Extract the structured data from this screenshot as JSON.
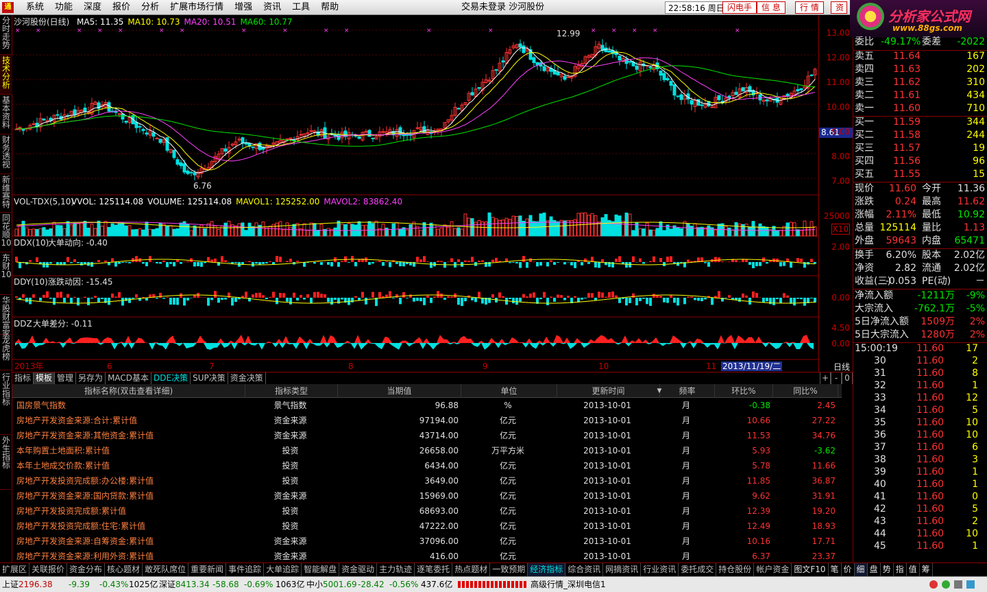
{
  "menu": {
    "logo": "通",
    "items": [
      "系统",
      "功能",
      "深度",
      "报价",
      "分析",
      "扩展市场行情",
      "增强",
      "资讯",
      "工具",
      "帮助"
    ],
    "center": "交易未登录   沙河股份",
    "clock": "22:58:16 周日",
    "buttons": [
      "闪电手",
      "信 息",
      "行 情",
      "资"
    ]
  },
  "brand": {
    "title": "分析家公式网",
    "url": "www.88gs.com"
  },
  "left_tabs": [
    "分时走势",
    "技术分析",
    "基本资料",
    "财务透视",
    "新维赛特",
    "同花顺10",
    "东财10",
    "华股财富家",
    "龙虎榜",
    "行业指标",
    "外生指标"
  ],
  "chart": {
    "title": "沙河股份(日线)",
    "ma": [
      {
        "label": "MA5: 11.35",
        "color": "#ffffff"
      },
      {
        "label": "MA10: 10.73",
        "color": "#ffff00"
      },
      {
        "label": "MA20: 10.51",
        "color": "#ff40ff"
      },
      {
        "label": "MA60: 10.77",
        "color": "#00e600"
      }
    ],
    "price_axis": [
      "13.00",
      "12.00",
      "11.00",
      "10.00",
      "9.00",
      "8.00",
      "7.00"
    ],
    "price_tag": "8.61",
    "high_label": "12.99",
    "low_label": "6.76",
    "vol_title": "VOL-TDX(5,10)",
    "vol_items": [
      {
        "label": "VVOL: 125114.08",
        "color": "#ffffff"
      },
      {
        "label": "VOLUME: 125114.08",
        "color": "#ffffff"
      },
      {
        "label": "MAVOL1: 125252.00",
        "color": "#ffff00"
      },
      {
        "label": "MAVOL2: 83862.40",
        "color": "#ff40ff"
      }
    ],
    "vol_axis": "25000",
    "vol_unit": "X10",
    "ddx_title": "DDX(10)",
    "ddx_value": "大单动向: -0.40",
    "ddx_axis": "2.00",
    "ddy_title": "DDY(10)",
    "ddy_value": "涨跌动因: -15.45",
    "ddy_axis": "0.00",
    "ddz_title": "DDZ",
    "ddz_value": "大单差分: -0.11",
    "ddz_axis": [
      "4.50",
      "0.00"
    ],
    "date_axis": [
      "2013年",
      "6",
      "7",
      "8",
      "9",
      "10",
      "11"
    ],
    "cursor_date": "2013/11/19/二",
    "period": "日线"
  },
  "tabs": [
    "指标",
    "模板",
    "管理",
    "另存为",
    "MACD基本",
    "DDE决策",
    "SUP决策",
    "资金决策"
  ],
  "tab_controls": [
    "+",
    "-",
    "0"
  ],
  "table": {
    "headers": [
      "指标名称(双击查看详细)",
      "指标类型",
      "当期值",
      "单位",
      "更新时间",
      "频率",
      "环比%",
      "同比%"
    ],
    "rows": [
      {
        "name": "国房景气指数",
        "type": "景气指数",
        "value": "96.88",
        "unit": "%",
        "date": "2013-10-01",
        "freq": "月",
        "mom": "-0.38",
        "yoy": "2.45"
      },
      {
        "name": "房地产开发资金来源:合计:累计值",
        "type": "资金来源",
        "value": "97194.00",
        "unit": "亿元",
        "date": "2013-10-01",
        "freq": "月",
        "mom": "10.66",
        "yoy": "27.22"
      },
      {
        "name": "房地产开发资金来源:其他资金:累计值",
        "type": "资金来源",
        "value": "43714.00",
        "unit": "亿元",
        "date": "2013-10-01",
        "freq": "月",
        "mom": "11.53",
        "yoy": "34.76"
      },
      {
        "name": "本年购置土地面积:累计值",
        "type": "投资",
        "value": "26658.00",
        "unit": "万平方米",
        "date": "2013-10-01",
        "freq": "月",
        "mom": "5.93",
        "yoy": "-3.62"
      },
      {
        "name": "本年土地成交价款:累计值",
        "type": "投资",
        "value": "6434.00",
        "unit": "亿元",
        "date": "2013-10-01",
        "freq": "月",
        "mom": "5.78",
        "yoy": "11.66"
      },
      {
        "name": "房地产开发投资完成额:办公楼:累计值",
        "type": "投资",
        "value": "3649.00",
        "unit": "亿元",
        "date": "2013-10-01",
        "freq": "月",
        "mom": "11.85",
        "yoy": "36.87"
      },
      {
        "name": "房地产开发资金来源:国内贷款:累计值",
        "type": "资金来源",
        "value": "15969.00",
        "unit": "亿元",
        "date": "2013-10-01",
        "freq": "月",
        "mom": "9.62",
        "yoy": "31.91"
      },
      {
        "name": "房地产开发投资完成额:累计值",
        "type": "投资",
        "value": "68693.00",
        "unit": "亿元",
        "date": "2013-10-01",
        "freq": "月",
        "mom": "12.39",
        "yoy": "19.20"
      },
      {
        "name": "房地产开发投资完成额:住宅:累计值",
        "type": "投资",
        "value": "47222.00",
        "unit": "亿元",
        "date": "2013-10-01",
        "freq": "月",
        "mom": "12.49",
        "yoy": "18.93"
      },
      {
        "name": "房地产开发资金来源:自筹资金:累计值",
        "type": "资金来源",
        "value": "37096.00",
        "unit": "亿元",
        "date": "2013-10-01",
        "freq": "月",
        "mom": "10.16",
        "yoy": "17.71"
      },
      {
        "name": "房地产开发资金来源:利用外资:累计值",
        "type": "资金来源",
        "value": "416.00",
        "unit": "亿元",
        "date": "2013-10-01",
        "freq": "月",
        "mom": "6.37",
        "yoy": "23.37"
      }
    ]
  },
  "quote": {
    "wb": {
      "label": "委比",
      "value": "-49.17%",
      "label2": "委差",
      "value2": "-2022"
    },
    "asks": [
      {
        "l": "卖五",
        "p": "11.64",
        "v": "167"
      },
      {
        "l": "卖四",
        "p": "11.63",
        "v": "202"
      },
      {
        "l": "卖三",
        "p": "11.62",
        "v": "310"
      },
      {
        "l": "卖二",
        "p": "11.61",
        "v": "434"
      },
      {
        "l": "卖一",
        "p": "11.60",
        "v": "710"
      }
    ],
    "bids": [
      {
        "l": "买一",
        "p": "11.59",
        "v": "344"
      },
      {
        "l": "买二",
        "p": "11.58",
        "v": "244"
      },
      {
        "l": "买三",
        "p": "11.57",
        "v": "19"
      },
      {
        "l": "买四",
        "p": "11.56",
        "v": "96"
      },
      {
        "l": "买五",
        "p": "11.55",
        "v": "15"
      }
    ],
    "stats": [
      {
        "l1": "现价",
        "v1": "11.60",
        "c1": "red",
        "l2": "今开",
        "v2": "11.36",
        "c2": "wht"
      },
      {
        "l1": "涨跌",
        "v1": "0.24",
        "c1": "red",
        "l2": "最高",
        "v2": "11.62",
        "c2": "red"
      },
      {
        "l1": "涨幅",
        "v1": "2.11%",
        "c1": "red",
        "l2": "最低",
        "v2": "10.92",
        "c2": "green"
      },
      {
        "l1": "总量",
        "v1": "125114",
        "c1": "yel",
        "l2": "量比",
        "v2": "1.13",
        "c2": "red"
      },
      {
        "l1": "外盘",
        "v1": "59643",
        "c1": "red",
        "l2": "内盘",
        "v2": "65471",
        "c2": "green"
      }
    ],
    "stats2": [
      {
        "l1": "换手",
        "v1": "6.20%",
        "c1": "wht",
        "l2": "股本",
        "v2": "2.02亿",
        "c2": "wht"
      },
      {
        "l1": "净资",
        "v1": "2.82",
        "c1": "wht",
        "l2": "流通",
        "v2": "2.02亿",
        "c2": "wht"
      },
      {
        "l1": "收益(三)",
        "v1": "-0.053",
        "c1": "wht",
        "l2": "PE(动)",
        "v2": "－",
        "c2": "wht"
      }
    ],
    "flows": [
      {
        "l": "净流入额",
        "v": "-1211万",
        "p": "-9%",
        "c": "green"
      },
      {
        "l": "大宗流入",
        "v": "-762.1万",
        "p": "-5%",
        "c": "green"
      },
      {
        "l": "5日净流入额",
        "v": "1509万",
        "p": "2%",
        "c": "red"
      },
      {
        "l": "5日大宗流入",
        "v": "1280万",
        "p": "2%",
        "c": "red"
      }
    ],
    "ticks": [
      {
        "t": "15:00:19",
        "p": "11.60",
        "v": "17"
      },
      {
        "t": "30",
        "p": "11.60",
        "v": "2"
      },
      {
        "t": "31",
        "p": "11.60",
        "v": "8"
      },
      {
        "t": "32",
        "p": "11.60",
        "v": "1"
      },
      {
        "t": "33",
        "p": "11.60",
        "v": "12"
      },
      {
        "t": "34",
        "p": "11.60",
        "v": "5"
      },
      {
        "t": "35",
        "p": "11.60",
        "v": "10"
      },
      {
        "t": "36",
        "p": "11.60",
        "v": "10"
      },
      {
        "t": "37",
        "p": "11.60",
        "v": "6"
      },
      {
        "t": "38",
        "p": "11.60",
        "v": "3"
      },
      {
        "t": "39",
        "p": "11.60",
        "v": "1"
      },
      {
        "t": "40",
        "p": "11.60",
        "v": "1"
      },
      {
        "t": "41",
        "p": "11.60",
        "v": "0"
      },
      {
        "t": "42",
        "p": "11.60",
        "v": "5"
      },
      {
        "t": "43",
        "p": "11.60",
        "v": "2"
      },
      {
        "t": "44",
        "p": "11.60",
        "v": "10"
      },
      {
        "t": "45",
        "p": "11.60",
        "v": "1"
      }
    ]
  },
  "bottom_tabs": [
    "扩展区",
    "关联报价",
    "资金分布",
    "核心题材",
    "敢死队席位",
    "重要新闻",
    "事件追踪",
    "大单追踪",
    "智能解盘",
    "资金驱动",
    "主力轨迹",
    "逐笔委托",
    "热点题材",
    "一致预期",
    "经济指标",
    "综合资讯",
    "网摘资讯",
    "行业资讯",
    "委托成交",
    "持仓股份",
    "帐户资金",
    "图文F10",
    "笔",
    "价",
    "细",
    "盘",
    "势",
    "指",
    "值",
    "筹"
  ],
  "status": {
    "sh_label": "上证",
    "sh_val": "2196.38",
    "sh_chg": "-9.39",
    "sh_pct": "-0.43%",
    "sh_amt": "1025亿",
    "sz_label": "深证",
    "sz_val": "8413.34",
    "sz_chg": "-58.68",
    "sz_pct": "-0.69%",
    "sz_amt": "1063亿",
    "zx_label": "中小",
    "zx_val": "5001.69",
    "zx_chg": "-28.42",
    "zx_pct": "-0.56%",
    "zx_amt": "437.6亿",
    "server": "高级行情_深圳电信1"
  }
}
